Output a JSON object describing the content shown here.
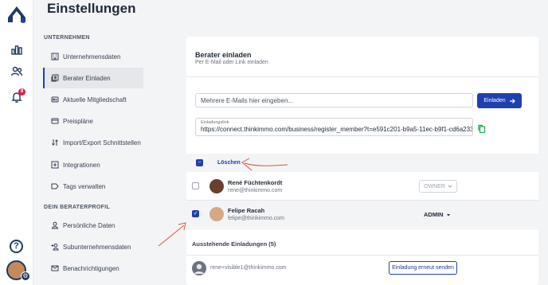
{
  "page": {
    "title": "Einstellungen"
  },
  "rail": {
    "notification_count": "8",
    "icons": [
      "logo-icon",
      "chart-icon",
      "users-icon",
      "bell-icon",
      "help-icon",
      "avatar"
    ]
  },
  "nav": {
    "section_company": "UNTERNEHMEN",
    "company_items": [
      {
        "label": "Unternehmensdaten",
        "icon": "building-icon"
      },
      {
        "label": "Berater Einladen",
        "icon": "invite-icon",
        "active": true
      },
      {
        "label": "Aktuelle Mitgliedschaft",
        "icon": "membership-icon"
      },
      {
        "label": "Preispläne",
        "icon": "card-icon"
      },
      {
        "label": "Import/Export Schnittstellen",
        "icon": "import-export-icon"
      },
      {
        "label": "Integrationen",
        "icon": "integration-icon"
      },
      {
        "label": "Tags verwalten",
        "icon": "tag-icon"
      }
    ],
    "section_profile": "DEIN BERATERPROFIL",
    "profile_items": [
      {
        "label": "Persönliche Daten",
        "icon": "person-icon"
      },
      {
        "label": "Subunternehmensdaten",
        "icon": "person-add-icon"
      },
      {
        "label": "Benachrichtigungen",
        "icon": "mail-icon"
      }
    ]
  },
  "invite": {
    "title": "Berater einladen",
    "subtitle": "Per E-Mail oder Link einladen",
    "email_placeholder": "Mehrere E-Mails hier eingeben...",
    "invite_button": "Einladen",
    "link_label": "Einladungslink",
    "link_value": "https://connect.thinkimmo.com/business/register_member?t=e591c201-b9a5-11ec-b9f1-cd6a233c"
  },
  "members": {
    "delete_label": "Löschen",
    "rows": [
      {
        "name": "René Füchtenkordt",
        "email": "rene@thinkimmo.com",
        "role": "OWNER",
        "checked": false
      },
      {
        "name": "Felipe Racah",
        "email": "felipe@thinkimmo.com",
        "role": "ADMIN",
        "checked": true
      }
    ]
  },
  "pending": {
    "title": "Ausstehende Einladungen (5)",
    "email": "rene+visible1@thinkimmo.com",
    "resend_button": "Einladung erneut senden"
  },
  "colors": {
    "primary": "#1e40af",
    "annotation": "#e0533a",
    "notification": "#e11d48",
    "copy": "#16a34a"
  }
}
